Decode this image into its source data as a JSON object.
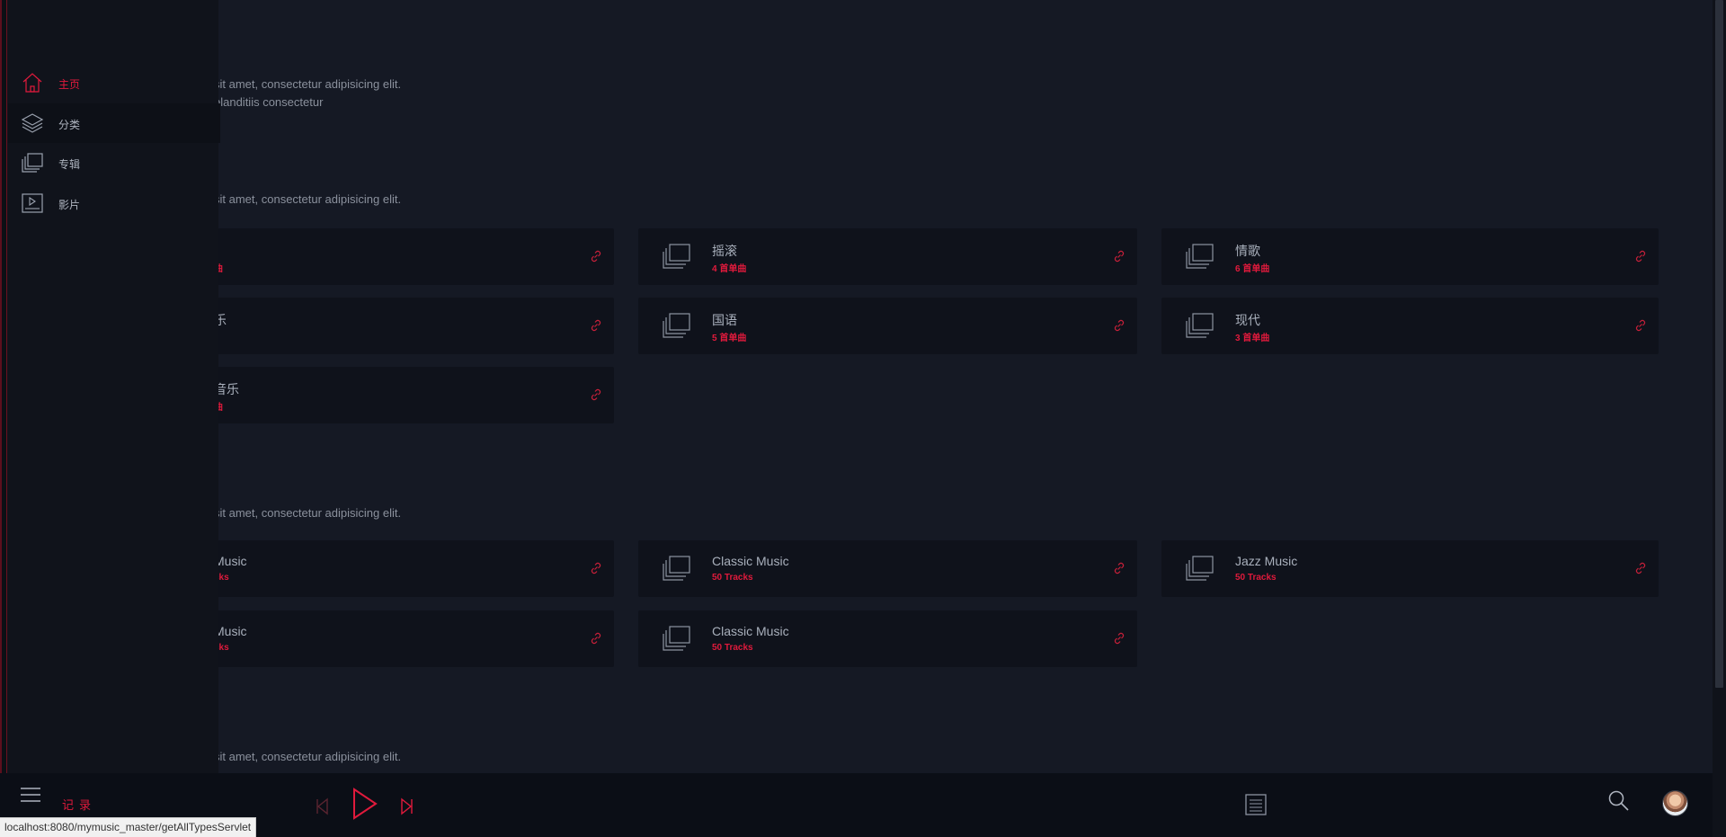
{
  "sections": [
    {
      "title": "",
      "desc_lines": [
        "sit amet, consectetur adipisicing elit.",
        "blanditiis consectetur"
      ]
    },
    {
      "title": "",
      "desc_lines": [
        "sit amet, consectetur adipisicing elit."
      ]
    },
    {
      "title": "",
      "desc_lines": [
        "sit amet, consectetur adipisicing elit."
      ]
    },
    {
      "title": "",
      "desc_lines": [
        "sit amet, consectetur adipisicing elit."
      ]
    }
  ],
  "categories": [
    {
      "title": "",
      "sub": "曲"
    },
    {
      "title": "摇滚",
      "sub": "4 首单曲"
    },
    {
      "title": "情歌",
      "sub": "6 首单曲"
    },
    {
      "title": "乐",
      "sub": ""
    },
    {
      "title": "国语",
      "sub": "5 首单曲"
    },
    {
      "title": "现代",
      "sub": "3 首单曲"
    },
    {
      "title": "音乐",
      "sub": "曲"
    }
  ],
  "albums": [
    {
      "title": "Music",
      "sub": "cks"
    },
    {
      "title": "Classic Music",
      "sub": "50 Tracks"
    },
    {
      "title": "Jazz Music",
      "sub": "50 Tracks"
    },
    {
      "title": "Music",
      "sub": "cks"
    },
    {
      "title": "Classic Music",
      "sub": "50 Tracks"
    }
  ],
  "sidebar": {
    "items": [
      {
        "label": "主页",
        "icon": "home-icon",
        "active": true
      },
      {
        "label": "分类",
        "icon": "layers-icon",
        "active": false
      },
      {
        "label": "专辑",
        "icon": "albums-icon",
        "active": false
      },
      {
        "label": "影片",
        "icon": "video-icon",
        "active": false
      }
    ]
  },
  "player": {
    "record_label": "记录",
    "icons": [
      "menu-icon",
      "previous-icon",
      "play-icon",
      "next-icon",
      "playlist-icon",
      "search-icon",
      "avatar"
    ]
  },
  "status_url": "localhost:8080/mymusic_master/getAllTypesServlet",
  "colors": {
    "accent": "#e01a3c",
    "background": "#151924",
    "card": "#0f121b",
    "sidebar": "#10131b"
  }
}
